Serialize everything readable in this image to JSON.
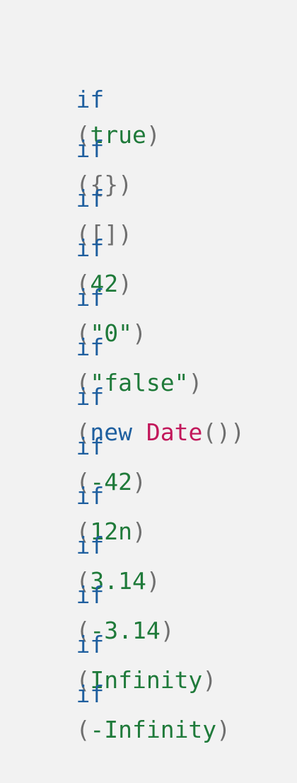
{
  "colors": {
    "background": "#f2f2f2",
    "keyword": "#1f5f9f",
    "punctuation": "#6f6f6f",
    "literal": "#1f7a3a",
    "class_name": "#c2185b"
  },
  "code_lines": [
    {
      "keyword": "if",
      "tokens": [
        {
          "text": "(",
          "kind": "punc"
        },
        {
          "text": "true",
          "kind": "lit"
        },
        {
          "text": ")",
          "kind": "punc"
        }
      ]
    },
    {
      "keyword": "if",
      "tokens": [
        {
          "text": "({})",
          "kind": "punc"
        }
      ]
    },
    {
      "keyword": "if",
      "tokens": [
        {
          "text": "([])",
          "kind": "punc"
        }
      ]
    },
    {
      "keyword": "if",
      "tokens": [
        {
          "text": "(",
          "kind": "punc"
        },
        {
          "text": "42",
          "kind": "lit"
        },
        {
          "text": ")",
          "kind": "punc"
        }
      ]
    },
    {
      "keyword": "if",
      "tokens": [
        {
          "text": "(",
          "kind": "punc"
        },
        {
          "text": "\"0\"",
          "kind": "lit"
        },
        {
          "text": ")",
          "kind": "punc"
        }
      ]
    },
    {
      "keyword": "if",
      "tokens": [
        {
          "text": "(",
          "kind": "punc"
        },
        {
          "text": "\"false\"",
          "kind": "lit"
        },
        {
          "text": ")",
          "kind": "punc"
        }
      ]
    },
    {
      "keyword": "if",
      "tokens": [
        {
          "text": "(",
          "kind": "punc"
        },
        {
          "text": "new",
          "kind": "kw"
        },
        {
          "text": " ",
          "kind": "punc"
        },
        {
          "text": "Date",
          "kind": "cls"
        },
        {
          "text": "())",
          "kind": "punc"
        }
      ]
    },
    {
      "keyword": "if",
      "tokens": [
        {
          "text": "(",
          "kind": "punc"
        },
        {
          "text": "-42",
          "kind": "lit"
        },
        {
          "text": ")",
          "kind": "punc"
        }
      ]
    },
    {
      "keyword": "if",
      "tokens": [
        {
          "text": "(",
          "kind": "punc"
        },
        {
          "text": "12n",
          "kind": "lit"
        },
        {
          "text": ")",
          "kind": "punc"
        }
      ]
    },
    {
      "keyword": "if",
      "tokens": [
        {
          "text": "(",
          "kind": "punc"
        },
        {
          "text": "3.14",
          "kind": "lit"
        },
        {
          "text": ")",
          "kind": "punc"
        }
      ]
    },
    {
      "keyword": "if",
      "tokens": [
        {
          "text": "(",
          "kind": "punc"
        },
        {
          "text": "-3.14",
          "kind": "lit"
        },
        {
          "text": ")",
          "kind": "punc"
        }
      ]
    },
    {
      "keyword": "if",
      "tokens": [
        {
          "text": "(",
          "kind": "punc"
        },
        {
          "text": "Infinity",
          "kind": "lit"
        },
        {
          "text": ")",
          "kind": "punc"
        }
      ]
    },
    {
      "keyword": "if",
      "tokens": [
        {
          "text": "(",
          "kind": "punc"
        },
        {
          "text": "-Infinity",
          "kind": "lit"
        },
        {
          "text": ")",
          "kind": "punc"
        }
      ]
    }
  ]
}
